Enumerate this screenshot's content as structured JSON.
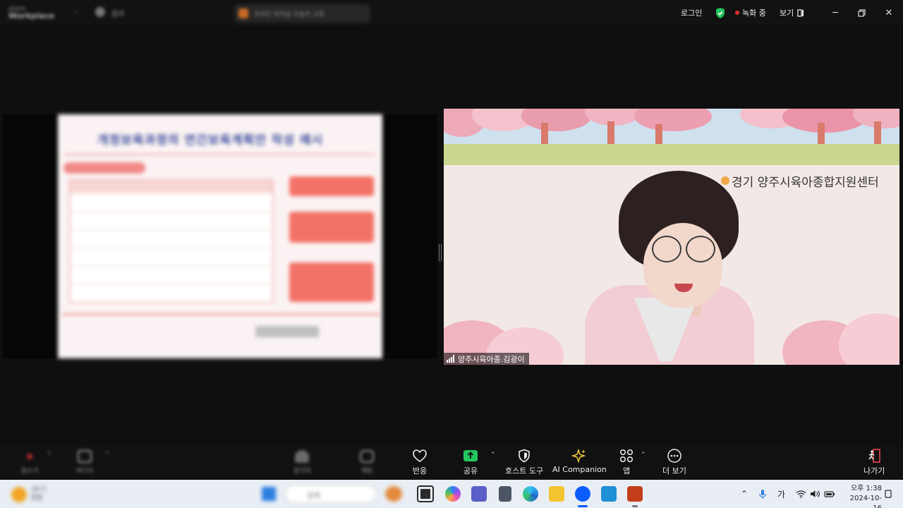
{
  "titlebar": {
    "brand_top": "zoom",
    "brand": "Workplace",
    "user": "홈바",
    "meeting_title": "온라인 회의실 오늘의 교육",
    "login": "로그인",
    "recording": "녹화 중",
    "view": "보기"
  },
  "share": {
    "slide_title": "개정보육과정의 연간보육계획안 작성 예시"
  },
  "video": {
    "center_name": "경기 양주시육아종합지원센터",
    "participant_name": "양주시육아종.김광이"
  },
  "toolbar": {
    "mute_label": "음소거",
    "video_label": "비디오",
    "participants_label": "참가자",
    "chat_label": "채팅",
    "react_label": "반응",
    "share_label": "공유",
    "host_tools_label": "호스트 도구",
    "ai_label": "AI Companion",
    "apps_label": "앱",
    "more_label": "더 보기",
    "leave_label": "나가기"
  },
  "taskbar": {
    "weather_temp": "16°C",
    "weather_desc": "맑음",
    "search": "검색",
    "ime": "가",
    "time": "오후 1:38",
    "date": "2024-10-16"
  },
  "colors": {
    "share_green": "#22c55e",
    "shield_green": "#20c05a",
    "record_red": "#e0302c",
    "leave_red": "#e5484d"
  }
}
